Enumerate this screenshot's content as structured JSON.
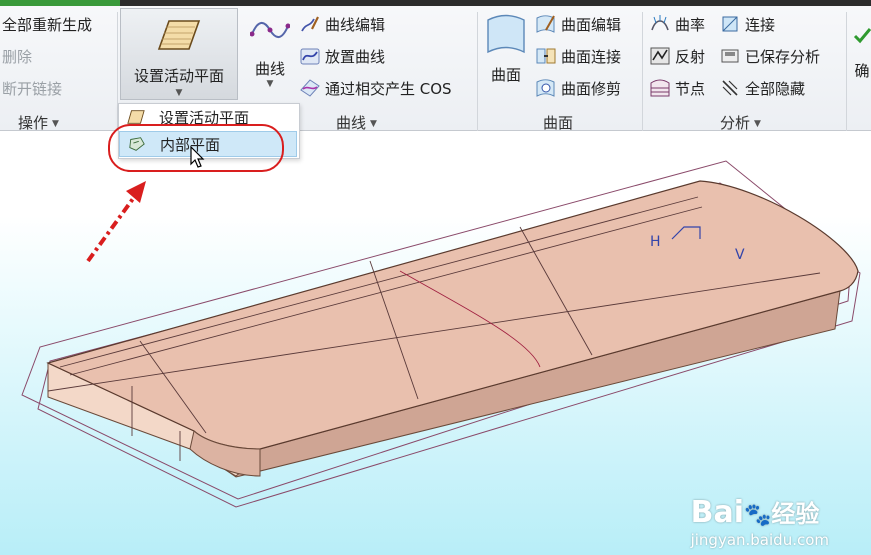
{
  "ribbon": {
    "operations": {
      "regenerate": "全部重新生成",
      "delete": "删除",
      "break_link": "断开链接",
      "group_label": "操作"
    },
    "set_plane": {
      "label": "设置活动平面"
    },
    "curve": {
      "big_label": "曲线",
      "edit": "曲线编辑",
      "place": "放置曲线",
      "intersect": "通过相交产生 COS",
      "group_label": "曲线"
    },
    "surface": {
      "big_label": "曲面",
      "edit": "曲面编辑",
      "connect": "曲面连接",
      "trim": "曲面修剪",
      "group_label": "曲面"
    },
    "analysis": {
      "curvature": "曲率",
      "reflection": "反射",
      "node": "节点",
      "connect": "连接",
      "saved": "已保存分析",
      "hide_all": "全部隐藏",
      "group_label": "分析"
    },
    "confirm": {
      "label": "确"
    }
  },
  "dropdown": {
    "items": [
      "设置活动平面",
      "内部平面"
    ]
  },
  "viewport": {
    "axis_labels": [
      "H",
      "V"
    ]
  },
  "watermark": {
    "brand": "Bai",
    "brand_suffix": "经验",
    "url": "jingyan.baidu.com"
  },
  "colors": {
    "accent_red": "#d91e1e",
    "part_fill": "#e9c0ae",
    "selection": "#cfe8f8"
  }
}
